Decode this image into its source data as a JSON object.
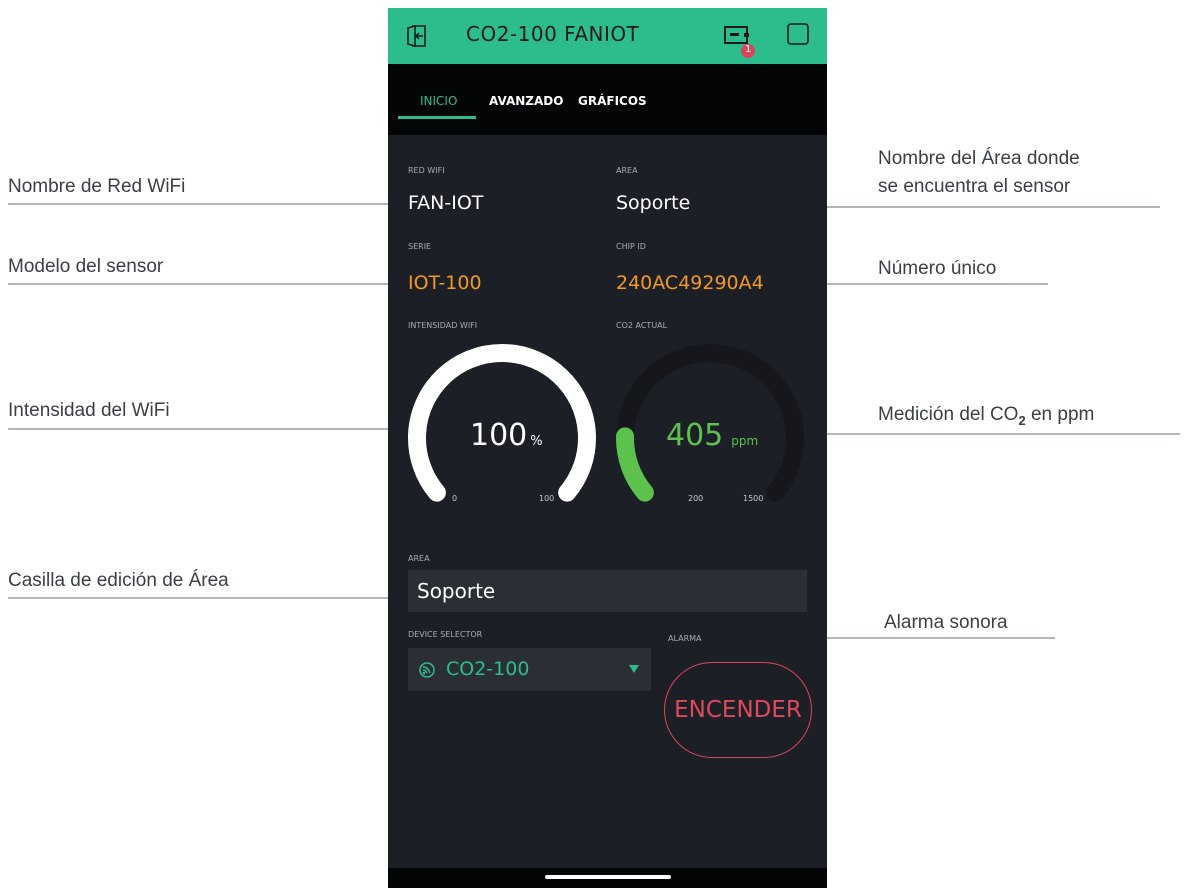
{
  "app": {
    "title": "CO2-100  FANIOT",
    "badge_count": "1",
    "accent_color": "#2dbd8c",
    "icons": [
      "exit-icon",
      "device-icon",
      "square-icon"
    ]
  },
  "tabs": [
    {
      "label": "INICIO",
      "active": true
    },
    {
      "label": "AVANZADO",
      "active": false
    },
    {
      "label": "GRÁFICOS",
      "active": false
    }
  ],
  "info": {
    "wifi_label": "RED WIFI",
    "wifi_value": "FAN-IOT",
    "area_label": "AREA",
    "area_value": "Soporte",
    "serie_label": "SERIE",
    "serie_value": "IOT-100",
    "chip_label": "CHIP ID",
    "chip_value": "240AC49290A4"
  },
  "gauges": {
    "wifi": {
      "label": "INTENSIDAD WIFI",
      "value": "100",
      "unit": "%",
      "min": "0",
      "max": "100",
      "fraction": 1.0,
      "color": "#ffffff"
    },
    "co2": {
      "label": "CO2 ACTUAL",
      "value": "405",
      "unit": "ppm",
      "min": "200",
      "max": "1500",
      "fraction": 0.158,
      "color": "#5cc24d"
    }
  },
  "area_edit": {
    "label": "AREA",
    "value": "Soporte"
  },
  "device_selector": {
    "label": "DEVICE SELECTOR",
    "value": "CO2-100"
  },
  "alarm": {
    "label": "ALARMA",
    "button": "ENCENDER"
  },
  "annotations": {
    "wifi_name": "Nombre de Red WiFi",
    "model": "Modelo del sensor",
    "wifi_strength": "Intensidad del WiFi",
    "area_edit": "Casilla de edición de Área",
    "area_name_line1": "Nombre del Área donde",
    "area_name_line2": "se encuentra el sensor",
    "unique": "Número único",
    "co2_pre": "Medición del CO",
    "co2_sub": "2",
    "co2_post": " en ppm",
    "alarm": "Alarma sonora"
  }
}
